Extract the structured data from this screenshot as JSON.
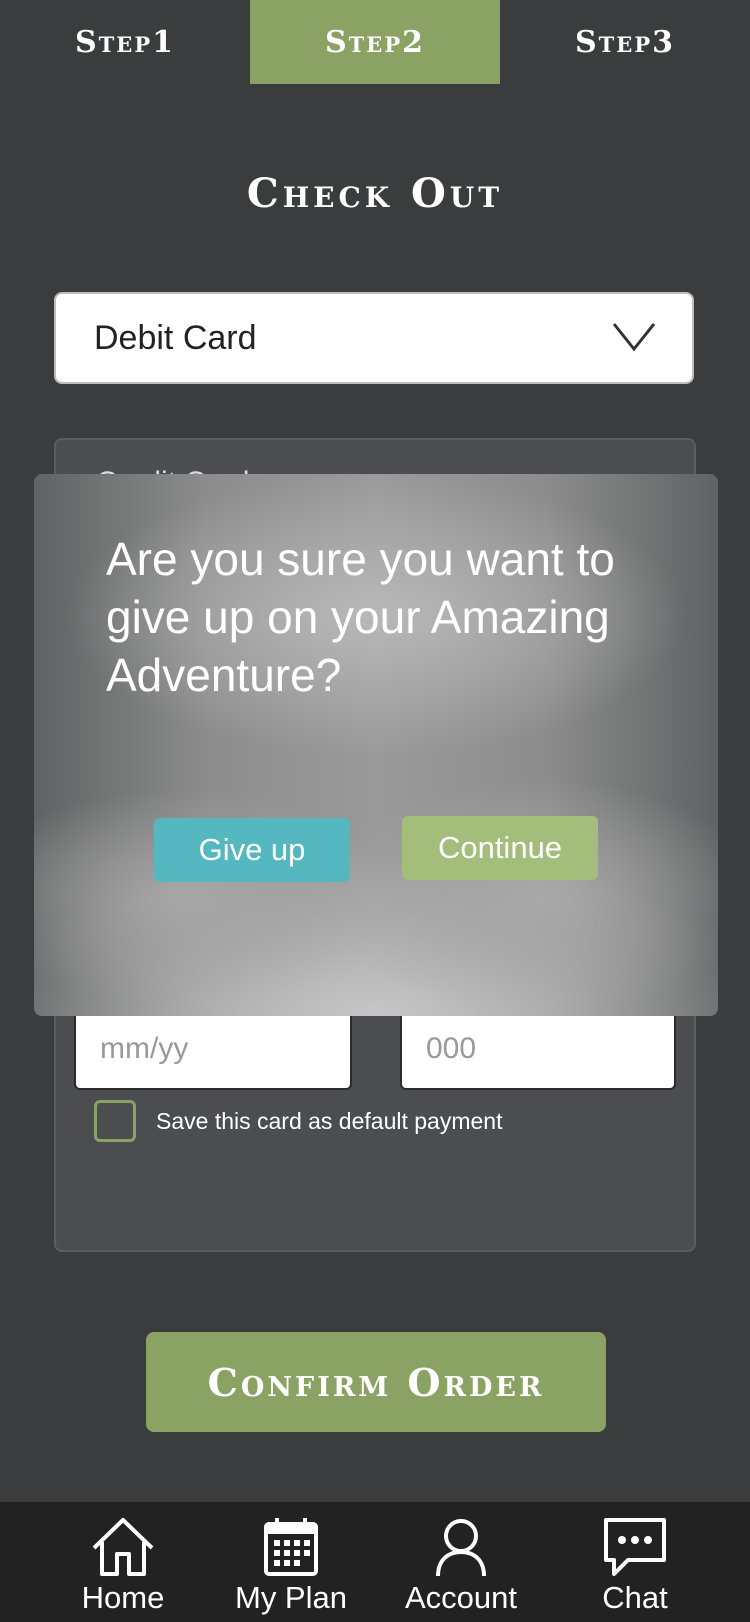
{
  "steps": [
    {
      "label": "Step1",
      "active": false
    },
    {
      "label": "Step2",
      "active": true
    },
    {
      "label": "Step3",
      "active": false
    }
  ],
  "page_title": "Check Out",
  "payment_method": {
    "selected": "Debit Card"
  },
  "card_form": {
    "section_label_peek": "Credit Card",
    "expiry_placeholder": "mm/yy",
    "cvv_placeholder": "000",
    "save_default_label": "Save this card as default payment",
    "save_default_checked": false
  },
  "confirm_button": "Confirm Order",
  "modal": {
    "message": "Are you sure you want to give up on your Amazing Adventure?",
    "give_up_button": "Give up",
    "continue_button": "Continue"
  },
  "tabbar": [
    {
      "label": "Home",
      "icon": "home-icon"
    },
    {
      "label": "My Plan",
      "icon": "calendar-icon"
    },
    {
      "label": "Account",
      "icon": "person-icon"
    },
    {
      "label": "Chat",
      "icon": "chat-bubble-icon"
    }
  ],
  "colors": {
    "background": "#3b3c3e",
    "accent_green": "#8aa264",
    "give_up_teal": "#55b7c0",
    "continue_green": "#a3bd7b",
    "tabbar": "#222223"
  }
}
